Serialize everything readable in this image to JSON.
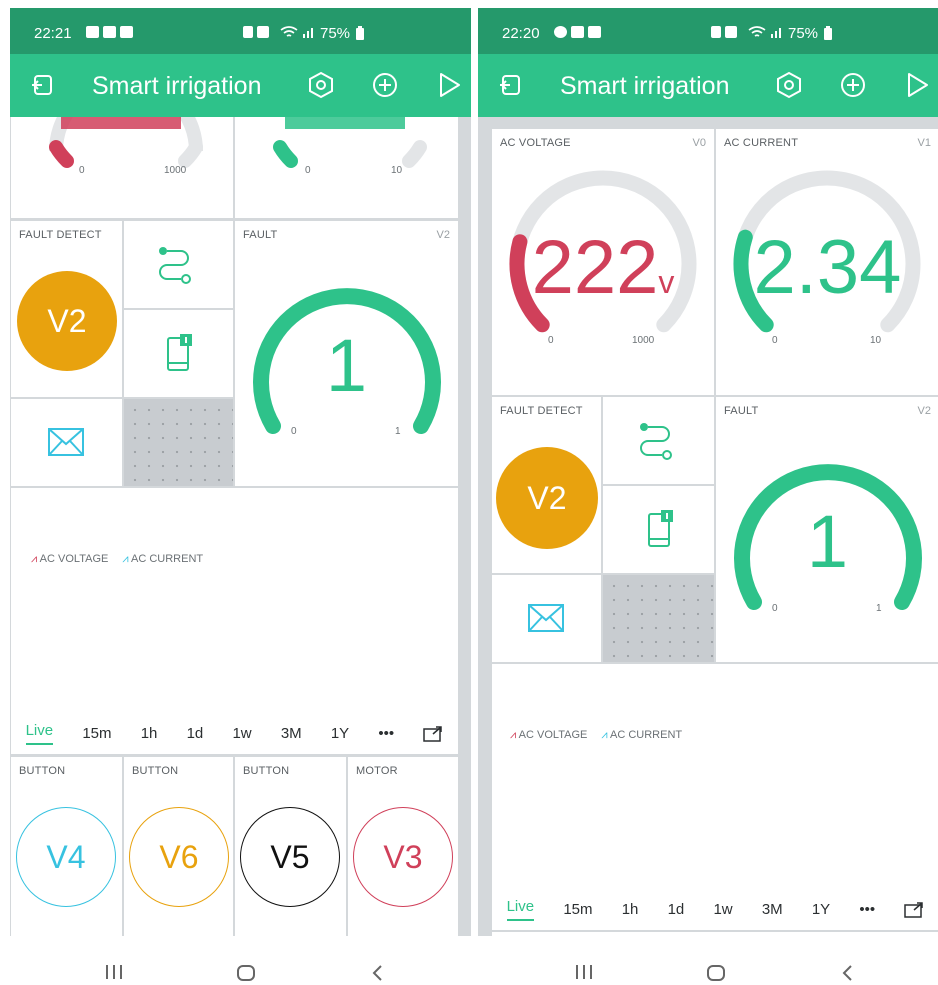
{
  "left": {
    "status": {
      "time": "22:21",
      "battery": "75%"
    },
    "appbar": {
      "title": "Smart irrigation"
    },
    "top_gauges": {
      "g1_min": "0",
      "g1_max": "1000",
      "g2_min": "0",
      "g2_max": "10"
    },
    "fault_detect": {
      "label": "FAULT DETECT",
      "value": "V2"
    },
    "fault": {
      "label": "FAULT",
      "pin": "V2",
      "value": "1",
      "min": "0",
      "max": "1"
    },
    "chart": {
      "legend": [
        "AC VOLTAGE",
        "AC CURRENT"
      ],
      "tabs": [
        "Live",
        "15m",
        "1h",
        "1d",
        "1w",
        "3M",
        "1Y",
        "•••"
      ]
    },
    "buttons": [
      {
        "label": "BUTTON",
        "value": "V4",
        "color": "#37c2e0"
      },
      {
        "label": "BUTTON",
        "value": "V6",
        "color": "#e8a20e"
      },
      {
        "label": "BUTTON",
        "value": "V5",
        "color": "#111111"
      },
      {
        "label": "MOTOR",
        "value": "V3",
        "color": "#d0405a"
      }
    ]
  },
  "right": {
    "status": {
      "time": "22:20",
      "battery": "75%"
    },
    "appbar": {
      "title": "Smart irrigation"
    },
    "voltage": {
      "label": "AC VOLTAGE",
      "pin": "V0",
      "value": "222",
      "unit": "v",
      "min": "0",
      "max": "1000",
      "level": 0.222,
      "color": "#d0405a"
    },
    "current": {
      "label": "AC CURRENT",
      "pin": "V1",
      "value": "2.34",
      "min": "0",
      "max": "10",
      "level": 0.234,
      "color": "#2ec28a"
    },
    "fault_detect": {
      "label": "FAULT DETECT",
      "value": "V2"
    },
    "fault": {
      "label": "FAULT",
      "pin": "V2",
      "value": "1",
      "min": "0",
      "max": "1"
    },
    "chart": {
      "legend": [
        "AC VOLTAGE",
        "AC CURRENT"
      ],
      "tabs": [
        "Live",
        "15m",
        "1h",
        "1d",
        "1w",
        "3M",
        "1Y",
        "•••"
      ]
    }
  },
  "colors": {
    "status_bar": "#25996b",
    "app_bar": "#2ec28a",
    "accent": "#2ec28a",
    "orange": "#e8a20e",
    "red": "#d0405a"
  }
}
